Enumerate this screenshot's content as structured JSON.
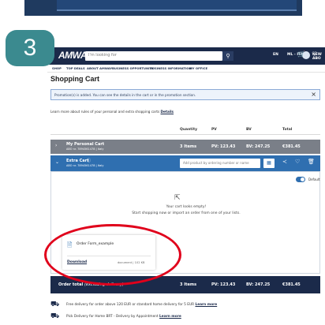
{
  "step": "3",
  "header": {
    "logo": "AMWAY",
    "search_placeholder": "I'm looking for",
    "search_icon": "search-icon",
    "language": "EN",
    "country": "ML - ITALY",
    "user_name": "NEW ABO",
    "cart_icon": "cart-icon",
    "wishlist_icon": "heart-icon"
  },
  "nav": {
    "items": [
      "SHOP",
      "TOP DEALS",
      "ABOUT AMWAY",
      "BUSINESS OPPORTUNITY",
      "BUSINESS INFORMATION",
      "MY OFFICE"
    ]
  },
  "page_title": "Shopping Cart",
  "promo": {
    "text": "Promotion(s) is added. You can see the details in the cart or in the promotion section.",
    "close_icon": "close-icon"
  },
  "learn": {
    "text": "Learn more about rules of your personal and extra shopping carts",
    "link": "Details"
  },
  "table": {
    "columns": [
      "Quantity",
      "PV",
      "BV",
      "Total"
    ]
  },
  "personal_cart": {
    "name": "My Personal Cart",
    "sub": "ABO nr. 7894561478 | Italy",
    "quantity": "3 Items",
    "pv": "PV: 123.43",
    "bv": "BV: 247.25",
    "total": "€381.45"
  },
  "extra_cart": {
    "name": "Extra Cart",
    "sub": "ABO nr. 7894561478 | Italy",
    "add_placeholder": "Add product by ordering number or name",
    "toggle_label": "Default"
  },
  "empty_cart": {
    "line1": "Your cart looks empty!",
    "line2": "Start shopping now or import an order from one of your lists."
  },
  "order_form": {
    "title": "Order Form_example",
    "download": "Download",
    "meta": "document | 102 KB"
  },
  "order_total": {
    "label": "Order total",
    "note": "(excluding delivery)",
    "quantity": "3 Items",
    "pv": "PV: 123.43",
    "bv": "BV: 247.25",
    "total": "€381.45"
  },
  "delivery": {
    "line1": "Free delivery for order above 120 EUR or standard home delivery for 5 EUR",
    "line1_link": "Learn more",
    "line2": "Pick Delivery for Home BRT - Delivery by Appointment",
    "line2_link": "Learn more"
  },
  "colors": {
    "header_navy": "#1b2a4a",
    "extra_cart_blue": "#2f6fb0",
    "personal_cart_grey": "#7a7f88",
    "highlight_red": "#e0001b",
    "step_badge_teal": "#3b8a8f"
  }
}
